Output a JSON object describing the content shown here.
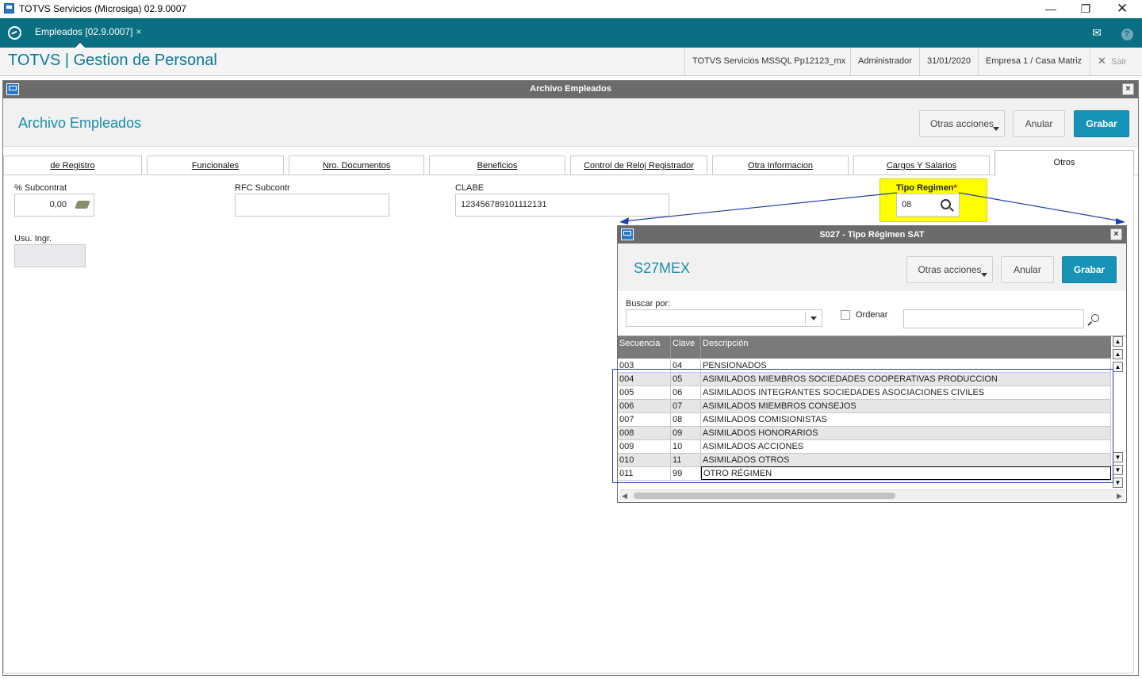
{
  "window": {
    "title": "TOTVS Servicios (Microsiga) 02.9.0007"
  },
  "apptab": {
    "label": "Empleados [02.9.0007]",
    "close": "×"
  },
  "header": {
    "title": "TOTVS | Gestion de Personal",
    "server": "TOTVS Servicios MSSQL Pp12123_mx",
    "user": "Administrador",
    "date": "31/01/2020",
    "company": "Empresa 1 / Casa Matriz",
    "exit": "Sair"
  },
  "main": {
    "window_title": "Archivo Empleados",
    "form_title": "Archivo Empleados",
    "buttons": {
      "other": "Otras acciones",
      "cancel": "Anular",
      "save": "Grabar"
    },
    "tabs": [
      {
        "label": "de Registro"
      },
      {
        "label": "Funcionales"
      },
      {
        "label": "Nro. Documentos"
      },
      {
        "label": "Beneficios"
      },
      {
        "label": "Control de Reloj Registrador"
      },
      {
        "label": "Otra Informacion"
      },
      {
        "label": "Cargos Y Salarios"
      },
      {
        "label": "Otros"
      }
    ],
    "fields": {
      "subcontrat_label": "% Subcontrat",
      "subcontrat_value": "0,00",
      "rfc_label": "RFC Subcontr",
      "rfc_value": "",
      "clabe_label": "CLABE",
      "clabe_value": "123456789101112131",
      "regimen_label": "Tipo Regimen",
      "regimen_required": "*",
      "regimen_value": "08",
      "usu_label": "Usu. Ingr.",
      "usu_value": ""
    }
  },
  "lookup": {
    "window_title": "S027 - Tipo Régimen SAT",
    "form_title": "S27MEX",
    "buttons": {
      "other": "Otras acciones",
      "cancel": "Anular",
      "save": "Grabar"
    },
    "search_label": "Buscar por:",
    "order_label": "Ordenar",
    "search_value": "",
    "columns": [
      "Secuencia",
      "Clave",
      "Descripción"
    ],
    "rows": [
      {
        "seq": "003",
        "key": "04",
        "desc": "PENSIONADOS"
      },
      {
        "seq": "004",
        "key": "05",
        "desc": "ASIMILADOS MIEMBROS SOCIEDADES COOPERATIVAS PRODUCCION"
      },
      {
        "seq": "005",
        "key": "06",
        "desc": "ASIMILADOS INTEGRANTES SOCIEDADES ASOCIACIONES CIVILES"
      },
      {
        "seq": "006",
        "key": "07",
        "desc": "ASIMILADOS MIEMBROS CONSEJOS"
      },
      {
        "seq": "007",
        "key": "08",
        "desc": "ASIMILADOS COMISIONISTAS"
      },
      {
        "seq": "008",
        "key": "09",
        "desc": "ASIMILADOS HONORARIOS"
      },
      {
        "seq": "009",
        "key": "10",
        "desc": "ASIMILADOS ACCIONES"
      },
      {
        "seq": "010",
        "key": "11",
        "desc": "ASIMILADOS OTROS"
      },
      {
        "seq": "011",
        "key": "99",
        "desc": "OTRO RÉGIMEN"
      }
    ]
  },
  "colors": {
    "teal_bar": "#0b6f84",
    "brand_text": "#0a7a9a",
    "primary_button": "#1793b8",
    "highlight": "#ffff00",
    "grid_header": "#7a7a7a"
  }
}
